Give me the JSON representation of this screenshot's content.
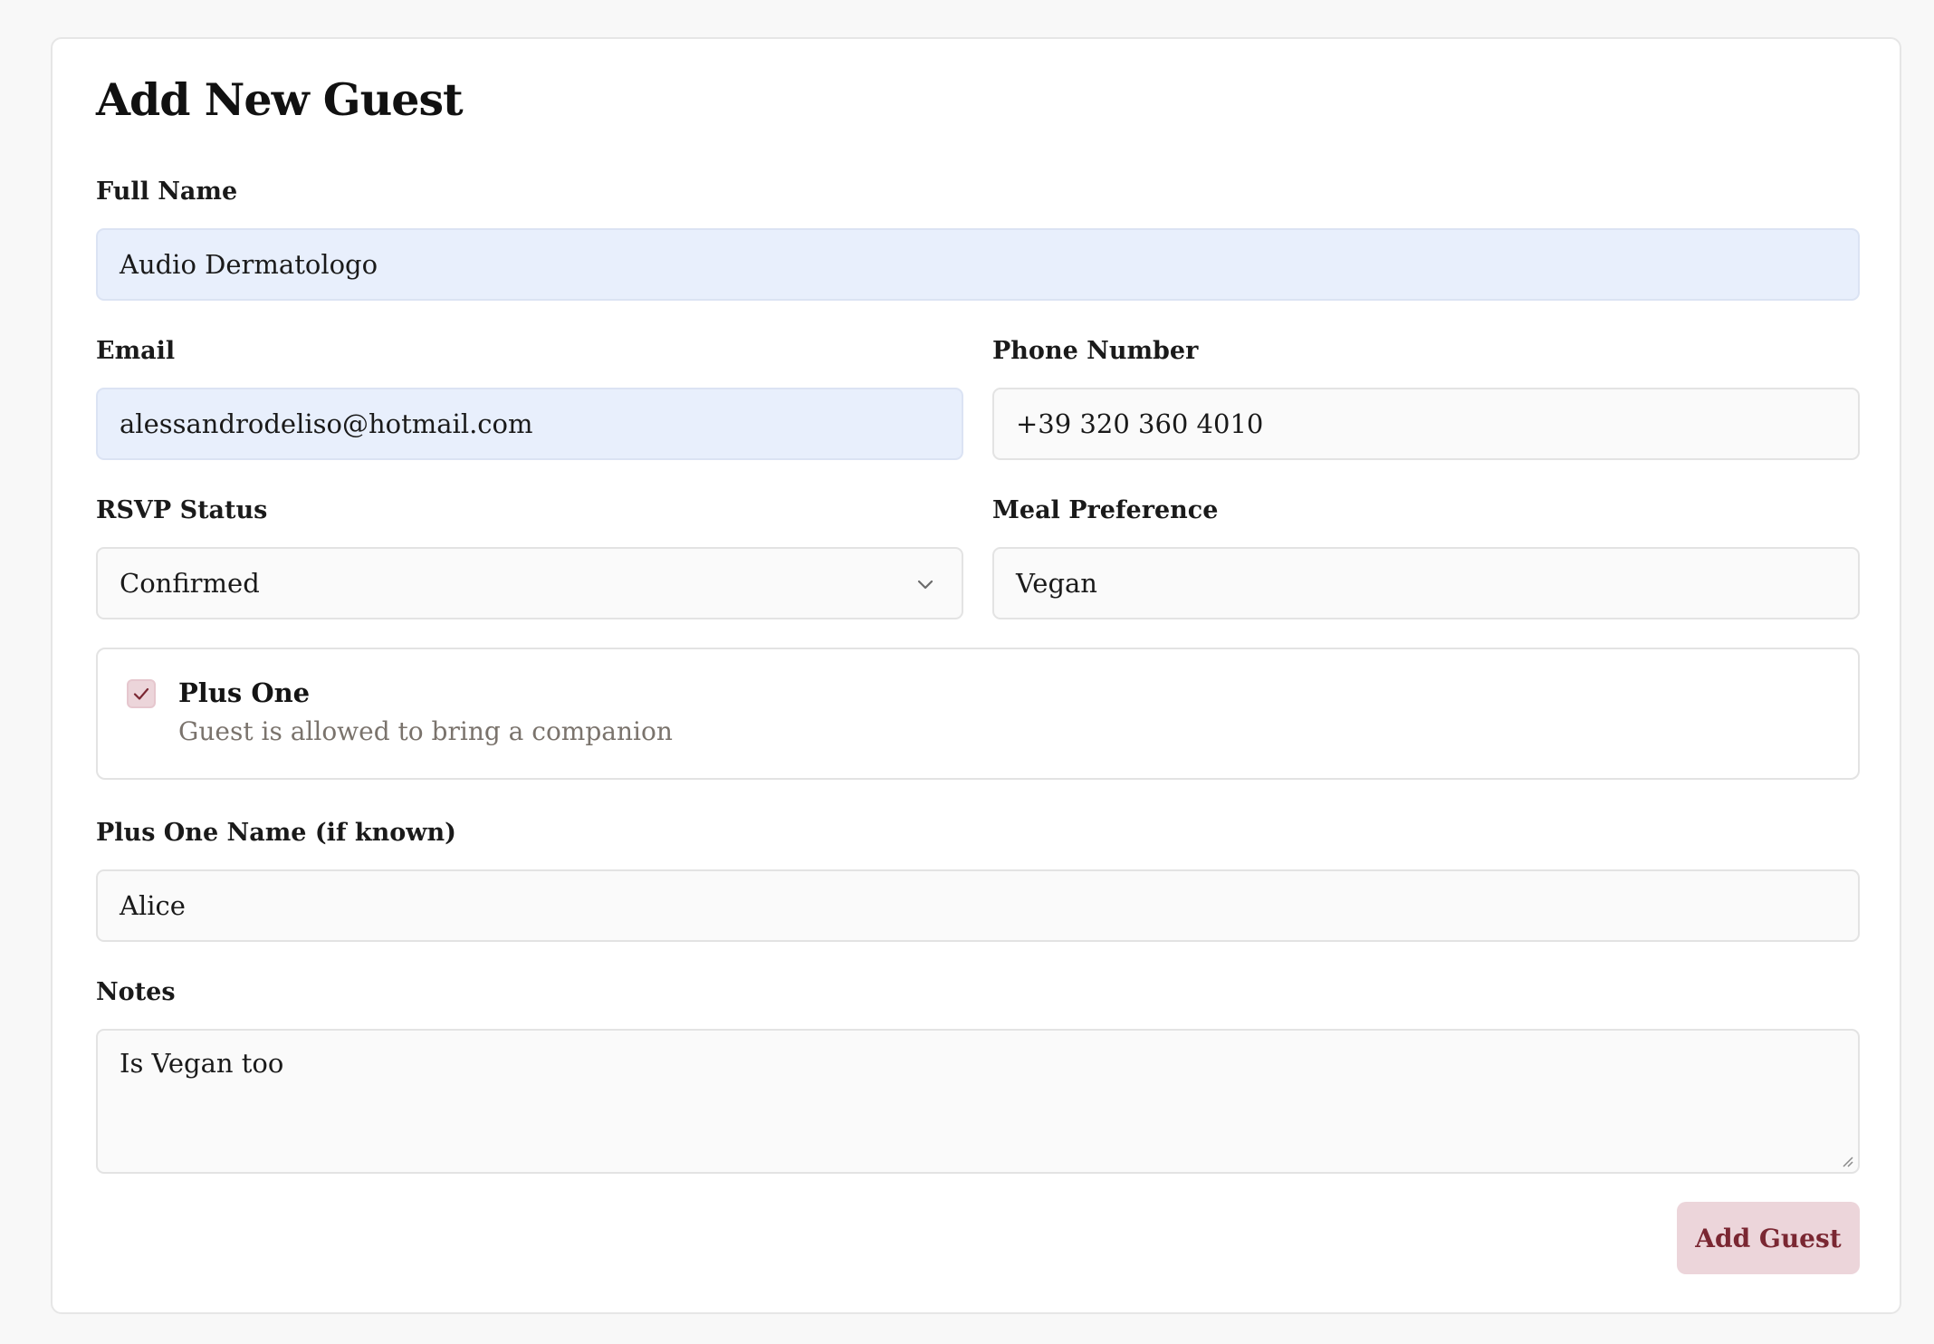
{
  "form": {
    "title": "Add New Guest",
    "full_name": {
      "label": "Full Name",
      "value": "Audio Dermatologo"
    },
    "email": {
      "label": "Email",
      "value": "alessandrodeliso@hotmail.com"
    },
    "phone": {
      "label": "Phone Number",
      "value": "+39 320 360 4010"
    },
    "rsvp": {
      "label": "RSVP Status",
      "value": "Confirmed"
    },
    "meal": {
      "label": "Meal Preference",
      "value": "Vegan"
    },
    "plus_one": {
      "title": "Plus One",
      "description": "Guest is allowed to bring a companion",
      "checked": true
    },
    "plus_one_name": {
      "label": "Plus One Name (if known)",
      "value": "Alice"
    },
    "notes": {
      "label": "Notes",
      "value": "Is Vegan too"
    },
    "submit_label": "Add Guest"
  },
  "colors": {
    "accent": "#7a2732",
    "accent_bg": "#ecd5da",
    "autofill_bg": "#e8effc",
    "muted_text": "#7a736c"
  },
  "icons": {
    "rsvp_dropdown": "chevron-down-icon",
    "plus_one_check": "check-icon",
    "notes_resize": "resize-handle-icon"
  }
}
